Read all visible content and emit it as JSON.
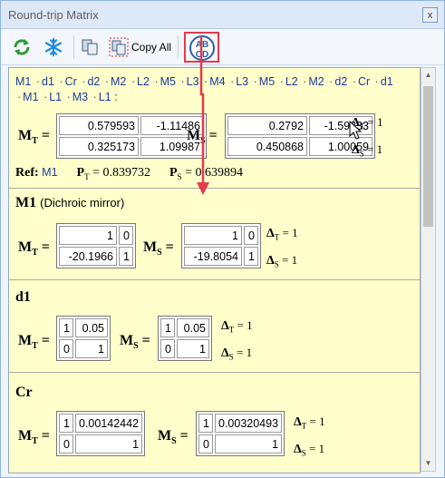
{
  "window": {
    "title": "Round-trip Matrix",
    "close_glyph": "x"
  },
  "toolbar": {
    "refresh_icon": "refresh-icon",
    "freeze_icon": "snowflake-icon",
    "copy_label": "Copy All",
    "abcd_top": "AB",
    "abcd_bottom": "CD"
  },
  "path": [
    "M1",
    "d1",
    "Cr",
    "d2",
    "M2",
    "L2",
    "M5",
    "L3",
    "M4",
    "L3",
    "M5",
    "L2",
    "M2",
    "d2",
    "Cr",
    "d1",
    "M1",
    "L1",
    "M3",
    "L1"
  ],
  "summary": {
    "mt": [
      [
        "0.579593",
        "-1.11486"
      ],
      [
        "0.325173",
        "1.09987"
      ]
    ],
    "ms": [
      [
        "0.2792",
        "-1.59833"
      ],
      [
        "0.450868",
        "1.00059"
      ]
    ],
    "delta_t": "1",
    "delta_s": "1",
    "ref_label": "Ref:",
    "ref_element": "M1",
    "pt": "0.839732",
    "ps": "0.639894"
  },
  "sections": [
    {
      "name": "M1",
      "desc": "(Dichroic mirror)",
      "mt": [
        [
          "1",
          "0"
        ],
        [
          "-20.1966",
          "1"
        ]
      ],
      "ms": [
        [
          "1",
          "0"
        ],
        [
          "-19.8054",
          "1"
        ]
      ],
      "delta_t": "1",
      "delta_s": "1"
    },
    {
      "name": "d1",
      "desc": "",
      "mt": [
        [
          "1",
          "0.05"
        ],
        [
          "0",
          "1"
        ]
      ],
      "ms": [
        [
          "1",
          "0.05"
        ],
        [
          "0",
          "1"
        ]
      ],
      "delta_t": "1",
      "delta_s": "1"
    },
    {
      "name": "Cr",
      "desc": "",
      "mt": [
        [
          "1",
          "0.00142442"
        ],
        [
          "0",
          "1"
        ]
      ],
      "ms": [
        [
          "1",
          "0.00320493"
        ],
        [
          "0",
          "1"
        ]
      ],
      "delta_t": "1",
      "delta_s": "1"
    }
  ],
  "colors": {
    "highlight": "#e23c4d",
    "link": "#1a3c9c",
    "panel": "#ffffcc"
  }
}
